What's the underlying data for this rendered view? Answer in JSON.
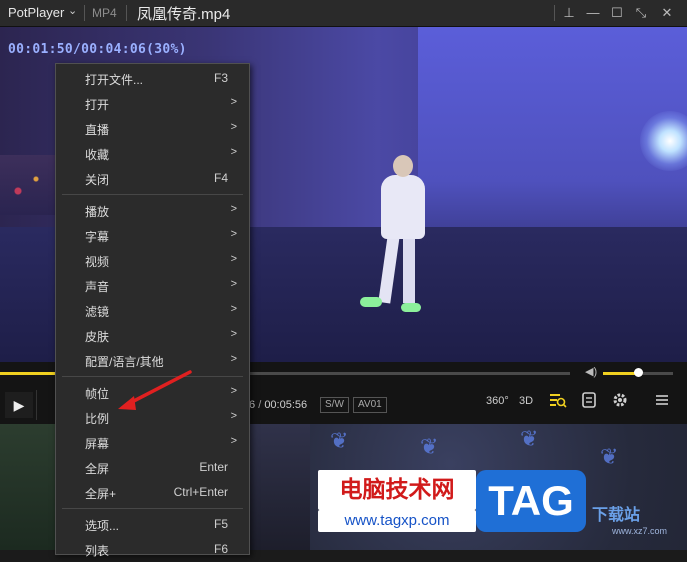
{
  "titlebar": {
    "app_name": "PotPlayer",
    "app_chevron": "⌄",
    "file_format": "MP4",
    "file_name": "凤凰传奇.mp4",
    "buttons": {
      "pin": "⊥",
      "minimize": "—",
      "maximize": "☐",
      "shrink": "⤡",
      "close": "✕"
    }
  },
  "video": {
    "time_overlay": "00:01:50/00:04:06(30%)"
  },
  "controls": {
    "seek_progress": 0.3,
    "volume_level": 0.5,
    "play_icon": "▶",
    "time_current_fragment": "6",
    "time_separator": "/",
    "time_total": "00:05:56",
    "sw_badge": "S/W",
    "audio_track_badge": "AV01",
    "vr_label": "360°",
    "three_d_label": "3D",
    "volume_icon": "◀)"
  },
  "context_menu": {
    "items": [
      {
        "label": "打开文件...",
        "shortcut": "F3",
        "submenu": false
      },
      {
        "label": "打开",
        "shortcut": "",
        "submenu": true
      },
      {
        "label": "直播",
        "shortcut": "",
        "submenu": true
      },
      {
        "label": "收藏",
        "shortcut": "",
        "submenu": true
      },
      {
        "label": "关闭",
        "shortcut": "F4",
        "submenu": false
      },
      {
        "label": "播放",
        "shortcut": "",
        "submenu": true
      },
      {
        "label": "字幕",
        "shortcut": "",
        "submenu": true
      },
      {
        "label": "视频",
        "shortcut": "",
        "submenu": true
      },
      {
        "label": "声音",
        "shortcut": "",
        "submenu": true
      },
      {
        "label": "滤镜",
        "shortcut": "",
        "submenu": true
      },
      {
        "label": "皮肤",
        "shortcut": "",
        "submenu": true
      },
      {
        "label": "配置/语言/其他",
        "shortcut": "",
        "submenu": true
      },
      {
        "label": "帧位",
        "shortcut": "",
        "submenu": true
      },
      {
        "label": "比例",
        "shortcut": "",
        "submenu": true
      },
      {
        "label": "屏幕",
        "shortcut": "",
        "submenu": true
      },
      {
        "label": "全屏",
        "shortcut": "Enter",
        "submenu": false
      },
      {
        "label": "全屏+",
        "shortcut": "Ctrl+Enter",
        "submenu": false
      },
      {
        "label": "选项...",
        "shortcut": "F5",
        "submenu": false
      },
      {
        "label": "列表",
        "shortcut": "F6",
        "submenu": false
      }
    ],
    "arrow_glyph": ">"
  },
  "watermark": {
    "text": "电脑技术网",
    "url": "www.tagxp.com",
    "tag": "TAG",
    "site": "下载站",
    "site_url": "www.xz7.com"
  },
  "colors": {
    "accent": "#f0d020",
    "annotation_arrow": "#e02020"
  }
}
